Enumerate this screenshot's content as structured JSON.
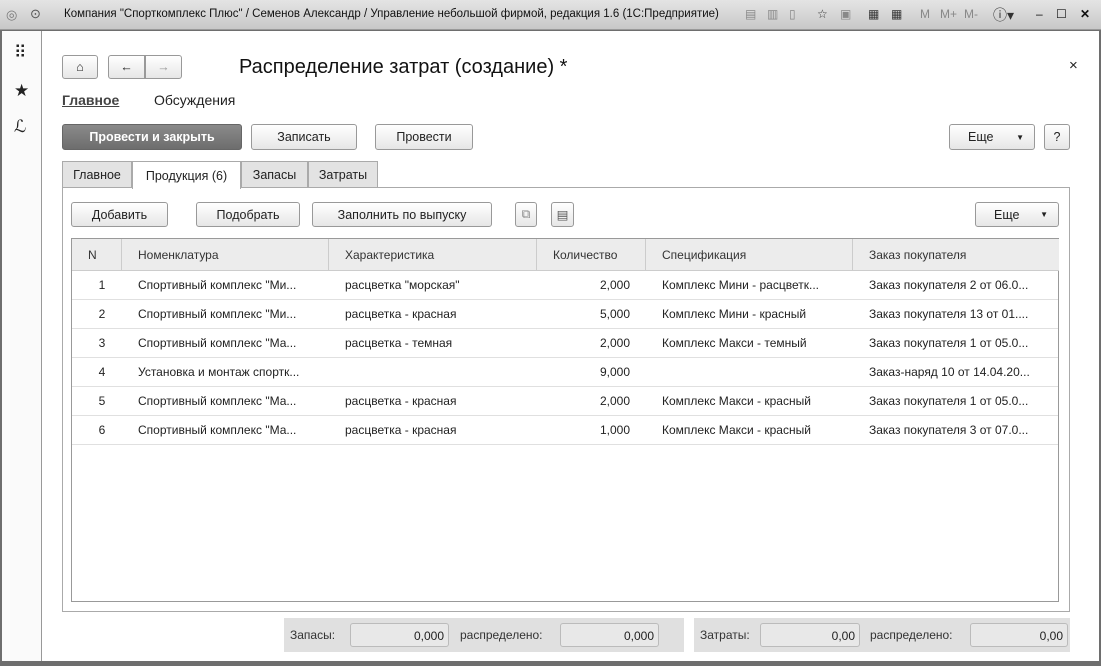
{
  "window": {
    "title": "Компания \"Спорткомплекс Плюс\" / Семенов Александр / Управление небольшой фирмой, редакция 1.6  (1С:Предприятие)",
    "toolbar": [
      "M",
      "M+",
      "M-"
    ]
  },
  "form": {
    "title": "Распределение затрат (создание) *",
    "close": "×",
    "nav": [
      "Главное",
      "Обсуждения"
    ],
    "commands": {
      "post_close": "Провести и закрыть",
      "save": "Записать",
      "post": "Провести",
      "more": "Еще",
      "help": "?"
    },
    "tabs": [
      "Главное",
      "Продукция (6)",
      "Запасы",
      "Затраты"
    ],
    "table_commands": {
      "add": "Добавить",
      "pick": "Подобрать",
      "fill": "Заполнить по выпуску",
      "more": "Еще"
    },
    "columns": [
      "N",
      "Номенклатура",
      "Характеристика",
      "Количество",
      "Спецификация",
      "Заказ покупателя"
    ],
    "rows": [
      [
        "1",
        "Спортивный комплекс \"Ми...",
        "расцветка \"морская\"",
        "2,000",
        "Комплекс Мини - расцветк...",
        "Заказ покупателя 2 от 06.0..."
      ],
      [
        "2",
        "Спортивный комплекс \"Ми...",
        "расцветка - красная",
        "5,000",
        "Комплекс Мини - красный",
        "Заказ покупателя 13 от 01...."
      ],
      [
        "3",
        "Спортивный комплекс \"Ма...",
        "расцветка - темная",
        "2,000",
        "Комплекс Макси - темный",
        "Заказ покупателя 1 от 05.0..."
      ],
      [
        "4",
        "Установка и монтаж спортк...",
        "",
        "9,000",
        "",
        "Заказ-наряд 10 от 14.04.20..."
      ],
      [
        "5",
        "Спортивный комплекс \"Ма...",
        "расцветка - красная",
        "2,000",
        "Комплекс Макси - красный",
        "Заказ покупателя 1 от 05.0..."
      ],
      [
        "6",
        "Спортивный комплекс \"Ма...",
        "расцветка - красная",
        "1,000",
        "Комплекс Макси - красный",
        "Заказ покупателя 3 от 07.0..."
      ]
    ],
    "footer": {
      "stock_label": "Запасы:",
      "stock": "0,000",
      "stock_dist_label": "распределено:",
      "stock_dist": "0,000",
      "cost_label": "Затраты:",
      "cost": "0,00",
      "cost_dist_label": "распределено:",
      "cost_dist": "0,00"
    }
  }
}
